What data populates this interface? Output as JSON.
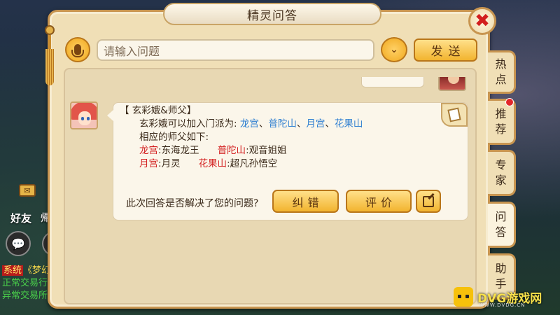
{
  "window": {
    "title": "精灵问答",
    "close_symbol": "✖"
  },
  "query_bar": {
    "placeholder": "请输入问题",
    "send_label": "发送",
    "dropdown_symbol": "⌄"
  },
  "answer": {
    "heading": "【 玄彩娥&师父】",
    "intro": "玄彩娥可以加入门派为:",
    "sects": [
      "龙宫",
      "普陀山",
      "月宫",
      "花果山"
    ],
    "sect_separator": "、",
    "masters_intro": "相应的师父如下:",
    "masters": [
      {
        "sect": "龙宫",
        "master": "东海龙王"
      },
      {
        "sect": "普陀山",
        "master": "观音姐姐"
      },
      {
        "sect": "月宫",
        "master": "月灵"
      },
      {
        "sect": "花果山",
        "master": "超凡孙悟空"
      }
    ],
    "colon": ":"
  },
  "feedback": {
    "question": "此次回答是否解决了您的问题?",
    "correct_label": "纠错",
    "rate_label": "评价"
  },
  "side_tabs": [
    {
      "label": "热点"
    },
    {
      "label": "推荐"
    },
    {
      "label": "专家"
    },
    {
      "label": "问答"
    },
    {
      "label": "助手"
    }
  ],
  "hud": {
    "friend_label": "好友",
    "friend_label_2": "帰",
    "chat_line_tag": "系统",
    "chat_line_1": "《梦幻",
    "chat_line_2": "正常交易行",
    "chat_line_3": "异常交易所"
  },
  "watermark": {
    "brand": "DVG游戏网",
    "url": "WWW.DVDG.CN"
  },
  "colors": {
    "panel_bg": "#f0dfb6",
    "panel_border": "#c89550",
    "button_gold": "#f2b42f",
    "sect_blue": "#2f7fd1",
    "sect_red": "#d32020",
    "close_red": "#d21e1e"
  }
}
